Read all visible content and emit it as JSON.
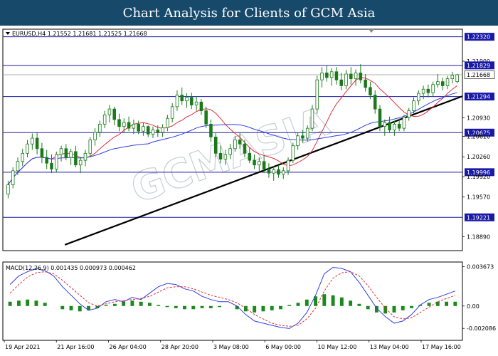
{
  "header": {
    "title": "Chart Analysis for Clients of GCM Asia"
  },
  "chart_data": {
    "type": "candlestick",
    "symbol_info": "EURUSD,H4  1.21552 1.21681 1.21525 1.21668",
    "watermark": "GCMASIA",
    "price_axis": {
      "ylim": [
        1.1865,
        1.2245
      ],
      "ticks": [
        {
          "value": 1.2232,
          "label": "1.22320",
          "highlight": true
        },
        {
          "value": 1.219,
          "label": "1.21900"
        },
        {
          "value": 1.21829,
          "label": "1.21829",
          "highlight": true
        },
        {
          "value": 1.21668,
          "label": "1.21668",
          "current": true
        },
        {
          "value": 1.21294,
          "label": "1.21294",
          "highlight": true
        },
        {
          "value": 1.2093,
          "label": "1.20930"
        },
        {
          "value": 1.20675,
          "label": "1.20675",
          "highlight": true
        },
        {
          "value": 1.2061,
          "label": "1.20610"
        },
        {
          "value": 1.2026,
          "label": "1.20260"
        },
        {
          "value": 1.19996,
          "label": "1.19996",
          "highlight": true
        },
        {
          "value": 1.1992,
          "label": "1.19920"
        },
        {
          "value": 1.1957,
          "label": "1.19570"
        },
        {
          "value": 1.19221,
          "label": "1.19221",
          "highlight": true
        },
        {
          "value": 1.1889,
          "label": "1.18890"
        }
      ]
    },
    "horizontal_levels": [
      1.2232,
      1.21829,
      1.21294,
      1.20675,
      1.19996,
      1.19221
    ],
    "current_price_line": 1.21668,
    "trendline": {
      "start": [
        0.135,
        1.1875
      ],
      "end": [
        1.0,
        1.213
      ]
    },
    "candles": [
      [
        1.1962,
        1.1985,
        1.1955,
        1.1978
      ],
      [
        1.1978,
        1.2008,
        1.1972,
        1.2002
      ],
      [
        1.2002,
        1.2025,
        1.1995,
        1.2018
      ],
      [
        1.2018,
        1.204,
        1.201,
        1.2032
      ],
      [
        1.2032,
        1.2055,
        1.2025,
        1.2048
      ],
      [
        1.2048,
        1.2066,
        1.2038,
        1.2058
      ],
      [
        1.2058,
        1.2068,
        1.203,
        1.204
      ],
      [
        1.204,
        1.205,
        1.2015,
        1.2025
      ],
      [
        1.2025,
        1.2038,
        1.2005,
        1.2015
      ],
      [
        1.2015,
        1.203,
        1.1998,
        1.2005
      ],
      [
        1.2005,
        1.2035,
        1.2,
        1.203
      ],
      [
        1.203,
        1.2045,
        1.2018,
        1.204
      ],
      [
        1.204,
        1.2048,
        1.202,
        1.2025
      ],
      [
        1.2025,
        1.204,
        1.2012,
        1.2035
      ],
      [
        1.2035,
        1.2045,
        1.2008,
        1.2012
      ],
      [
        1.2012,
        1.2025,
        1.1998,
        1.202
      ],
      [
        1.202,
        1.2038,
        1.201,
        1.2032
      ],
      [
        1.2032,
        1.206,
        1.2025,
        1.2055
      ],
      [
        1.2055,
        1.2075,
        1.2045,
        1.2068
      ],
      [
        1.2068,
        1.2088,
        1.206,
        1.2082
      ],
      [
        1.2082,
        1.2105,
        1.2075,
        1.2098
      ],
      [
        1.2098,
        1.2115,
        1.2085,
        1.2108
      ],
      [
        1.2108,
        1.2112,
        1.208,
        1.209
      ],
      [
        1.209,
        1.21,
        1.207,
        1.2078
      ],
      [
        1.2078,
        1.2092,
        1.2068,
        1.2085
      ],
      [
        1.2085,
        1.2095,
        1.207,
        1.2075
      ],
      [
        1.2075,
        1.209,
        1.2065,
        1.2082
      ],
      [
        1.2082,
        1.2088,
        1.2065,
        1.207
      ],
      [
        1.207,
        1.2085,
        1.2062,
        1.2078
      ],
      [
        1.2078,
        1.208,
        1.206,
        1.2065
      ],
      [
        1.2065,
        1.2078,
        1.2058,
        1.2072
      ],
      [
        1.2072,
        1.208,
        1.206,
        1.2068
      ],
      [
        1.2068,
        1.2082,
        1.206,
        1.2076
      ],
      [
        1.2076,
        1.2098,
        1.207,
        1.2092
      ],
      [
        1.2092,
        1.2118,
        1.2085,
        1.2112
      ],
      [
        1.2112,
        1.214,
        1.2105,
        1.2132
      ],
      [
        1.2132,
        1.2145,
        1.2115,
        1.2122
      ],
      [
        1.2122,
        1.2135,
        1.211,
        1.2128
      ],
      [
        1.2128,
        1.2136,
        1.2108,
        1.2115
      ],
      [
        1.2115,
        1.213,
        1.2105,
        1.212
      ],
      [
        1.212,
        1.2125,
        1.2098,
        1.2105
      ],
      [
        1.2105,
        1.2112,
        1.2075,
        1.2082
      ],
      [
        1.2082,
        1.209,
        1.2052,
        1.206
      ],
      [
        1.206,
        1.2068,
        1.2025,
        1.2032
      ],
      [
        1.2032,
        1.2045,
        1.2015,
        1.2022
      ],
      [
        1.2022,
        1.2038,
        1.2012,
        1.203
      ],
      [
        1.203,
        1.2048,
        1.2022,
        1.204
      ],
      [
        1.204,
        1.2062,
        1.2035,
        1.2055
      ],
      [
        1.2055,
        1.2068,
        1.204,
        1.2048
      ],
      [
        1.2048,
        1.2055,
        1.2025,
        1.2032
      ],
      [
        1.2032,
        1.2042,
        1.2015,
        1.202
      ],
      [
        1.202,
        1.203,
        1.2005,
        1.2012
      ],
      [
        1.2012,
        1.2025,
        1.2,
        1.2018
      ],
      [
        1.2018,
        1.2028,
        1.1998,
        1.2005
      ],
      [
        1.2005,
        1.2015,
        1.199,
        1.1998
      ],
      [
        1.1998,
        1.201,
        1.1985,
        1.2004
      ],
      [
        1.2004,
        1.2012,
        1.199,
        1.1996
      ],
      [
        1.1996,
        1.2008,
        1.1988,
        1.2002
      ],
      [
        1.2002,
        1.2025,
        1.1995,
        1.202
      ],
      [
        1.202,
        1.205,
        1.2015,
        1.2045
      ],
      [
        1.2045,
        1.2068,
        1.2038,
        1.2062
      ],
      [
        1.2062,
        1.2072,
        1.205,
        1.2058
      ],
      [
        1.2058,
        1.208,
        1.2052,
        1.2075
      ],
      [
        1.2075,
        1.2115,
        1.207,
        1.2108
      ],
      [
        1.2108,
        1.2165,
        1.21,
        1.2158
      ],
      [
        1.2158,
        1.218,
        1.2145,
        1.217
      ],
      [
        1.217,
        1.2182,
        1.2155,
        1.2162
      ],
      [
        1.2162,
        1.2178,
        1.2148,
        1.2172
      ],
      [
        1.2172,
        1.218,
        1.215,
        1.2158
      ],
      [
        1.2158,
        1.217,
        1.214,
        1.2148
      ],
      [
        1.2148,
        1.2175,
        1.2142,
        1.2168
      ],
      [
        1.2168,
        1.218,
        1.215,
        1.216
      ],
      [
        1.216,
        1.2176,
        1.2148,
        1.217
      ],
      [
        1.217,
        1.2185,
        1.2152,
        1.2158
      ],
      [
        1.2158,
        1.2168,
        1.2138,
        1.2145
      ],
      [
        1.2145,
        1.2155,
        1.2125,
        1.2132
      ],
      [
        1.2132,
        1.214,
        1.21,
        1.2108
      ],
      [
        1.2108,
        1.2115,
        1.207,
        1.2078
      ],
      [
        1.2078,
        1.209,
        1.2062,
        1.2085
      ],
      [
        1.2085,
        1.2095,
        1.2068,
        1.2072
      ],
      [
        1.2072,
        1.2088,
        1.2062,
        1.2082
      ],
      [
        1.2082,
        1.2092,
        1.207,
        1.2075
      ],
      [
        1.2075,
        1.2098,
        1.207,
        1.2094
      ],
      [
        1.2094,
        1.211,
        1.2088,
        1.2105
      ],
      [
        1.2105,
        1.2128,
        1.21,
        1.2122
      ],
      [
        1.2122,
        1.214,
        1.2115,
        1.2135
      ],
      [
        1.2135,
        1.2148,
        1.2125,
        1.2142
      ],
      [
        1.2142,
        1.215,
        1.2128,
        1.2136
      ],
      [
        1.2136,
        1.2155,
        1.213,
        1.215
      ],
      [
        1.215,
        1.2168,
        1.2145,
        1.2155
      ],
      [
        1.2155,
        1.2162,
        1.214,
        1.2148
      ],
      [
        1.2148,
        1.2165,
        1.2142,
        1.216
      ],
      [
        1.216,
        1.2172,
        1.2152,
        1.2166
      ],
      [
        1.2155,
        1.2168,
        1.2152,
        1.2167
      ]
    ],
    "x_labels": [
      "19 Apr 2021",
      "21 Apr 16:00",
      "26 Apr 04:00",
      "28 Apr 20:00",
      "3 May 08:00",
      "6 May 00:00",
      "10 May 12:00",
      "13 May 04:00",
      "17 May 16:00"
    ],
    "moving_averages": [
      {
        "color": "#e0303a",
        "period": 10
      },
      {
        "color": "#2c3fe0",
        "period": 30
      }
    ],
    "macd": {
      "label": "MACD(12,26,9) 0.001435 0.000973 0.000462",
      "ylim": [
        -0.0032,
        0.0041
      ],
      "ticks": [
        {
          "value": 0.003673,
          "label": "0.003673"
        },
        {
          "value": 0.0,
          "label": "0.00"
        },
        {
          "value": -0.002086,
          "label": "-0.002086"
        }
      ],
      "macd_line": [
        0.002,
        0.0028,
        0.0032,
        0.0035,
        0.0033,
        0.0028,
        0.0018,
        0.001,
        0.0002,
        -0.0004,
        -0.0002,
        0.0004,
        0.0006,
        0.0004,
        0.0008,
        0.0006,
        0.0012,
        0.0018,
        0.0021,
        0.002,
        0.0016,
        0.0014,
        0.0009,
        0.0006,
        0.0004,
        0.0004,
        0.0,
        -0.0008,
        -0.0014,
        -0.0016,
        -0.0018,
        -0.002,
        -0.0021,
        -0.0016,
        -0.0006,
        0.001,
        0.003,
        0.0036,
        0.0035,
        0.0032,
        0.0022,
        0.001,
        -0.0002,
        -0.001,
        -0.0016,
        -0.0014,
        -0.0008,
        0.0001,
        0.0006,
        0.0008,
        0.0011,
        0.0014
      ],
      "signal_line": [
        0.0012,
        0.002,
        0.0027,
        0.0031,
        0.0032,
        0.003,
        0.0024,
        0.0017,
        0.001,
        0.0003,
        0.0,
        0.0002,
        0.0004,
        0.0005,
        0.0006,
        0.0007,
        0.0009,
        0.0013,
        0.0017,
        0.0018,
        0.0018,
        0.0016,
        0.0013,
        0.001,
        0.0008,
        0.0006,
        0.0003,
        -0.0002,
        -0.0008,
        -0.0012,
        -0.0016,
        -0.0018,
        -0.0019,
        -0.0018,
        -0.0012,
        -0.0002,
        0.0014,
        0.0026,
        0.0031,
        0.0032,
        0.0028,
        0.0019,
        0.0008,
        -0.0002,
        -0.001,
        -0.0012,
        -0.0011,
        -0.0006,
        -0.0001,
        0.0004,
        0.0007,
        0.001
      ],
      "histogram": [
        0.0004,
        0.0005,
        0.0006,
        0.0005,
        0.0003,
        0.0,
        -0.0003,
        -0.0004,
        -0.0005,
        -0.0004,
        -0.0002,
        0.0001,
        0.0002,
        0.0004,
        0.0005,
        0.0004,
        0.0003,
        0.0001,
        -0.0001,
        -0.0002,
        -0.0003,
        -0.0003,
        -0.0002,
        -0.0002,
        -0.0001,
        0.0,
        -0.0003,
        -0.0005,
        -0.0006,
        -0.0005,
        -0.0004,
        -0.0003,
        0.0001,
        0.0003,
        0.0006,
        0.0009,
        0.0011,
        0.001,
        0.0008,
        0.0005,
        0.0002,
        -0.0003,
        -0.0006,
        -0.0007,
        -0.0006,
        -0.0004,
        -0.0002,
        0.0001,
        0.0003,
        0.0004,
        0.0004,
        0.0004
      ]
    }
  }
}
